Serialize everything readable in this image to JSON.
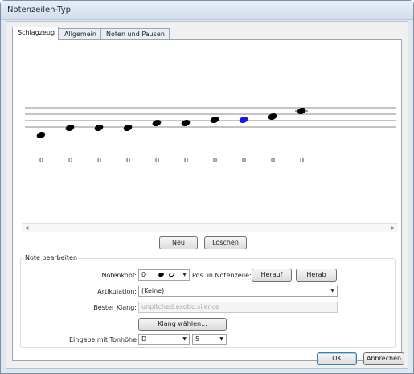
{
  "window": {
    "title": "Notenzeilen-Typ"
  },
  "tabs": [
    {
      "label": "Schlagzeug",
      "active": true
    },
    {
      "label": "Allgemein",
      "active": false
    },
    {
      "label": "Noten und Pausen",
      "active": false
    }
  ],
  "staff": {
    "notes": [
      {
        "label": "0",
        "selected": false
      },
      {
        "label": "0",
        "selected": false
      },
      {
        "label": "0",
        "selected": false
      },
      {
        "label": "0",
        "selected": false
      },
      {
        "label": "0",
        "selected": false
      },
      {
        "label": "0",
        "selected": false
      },
      {
        "label": "0",
        "selected": false
      },
      {
        "label": "0",
        "selected": true
      },
      {
        "label": "0",
        "selected": false
      },
      {
        "label": "0",
        "selected": false
      }
    ],
    "note_color": "#000000",
    "selected_color": "#1a1adc"
  },
  "staff_buttons": {
    "new": "Neu",
    "delete": "Löschen"
  },
  "edit": {
    "group_title": "Note bearbeiten",
    "notehead_label": "Notenkopf:",
    "notehead_value": "0",
    "position_label": "Pos. in Notenzeile:",
    "up_button": "Herauf",
    "down_button": "Herab",
    "articulation_label": "Artikulation:",
    "articulation_value": "(Keine)",
    "sound_label": "Bester Klang:",
    "sound_value": "unpitched.exotic.silence",
    "choose_sound_button": "Klang wählen...",
    "pitch_label": "Eingabe mit Tonhöhe",
    "pitch_value": "D",
    "octave_value": "5"
  },
  "dialog_buttons": {
    "ok": "OK",
    "cancel": "Abbrechen"
  }
}
